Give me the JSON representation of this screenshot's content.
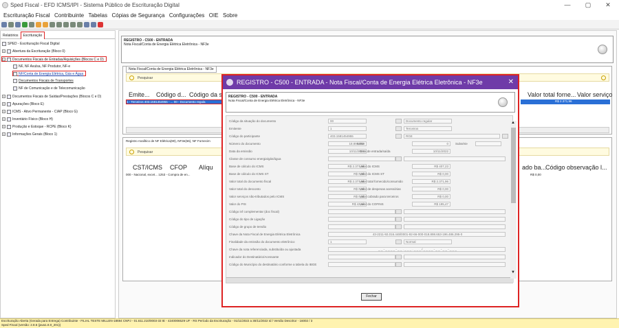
{
  "app": {
    "title": "Sped Fiscal - EFD ICMS/IPI - Sistema Público de Escrituração Digital",
    "min": "—",
    "max": "▢",
    "close": "✕"
  },
  "menu": [
    "Escrituração Fiscal",
    "Contribuinte",
    "Tabelas",
    "Cópias de Segurança",
    "Configurações",
    "OIE",
    "Sobre"
  ],
  "left_tabs": [
    "Relatórios",
    "Escrituração"
  ],
  "tree": [
    {
      "label": "SPED - Escrituração Fiscal Digital"
    },
    {
      "label": "Abertura da Escrituração (Bloco 0)"
    },
    {
      "label": "Documentos Fiscais de Entradas/Aquisições (Blocos C e D)"
    },
    {
      "label": "NF, NF Avulsa, NF Produtor, NF-e"
    },
    {
      "label": "NF/Conta de Energia Elétrica, Gás e Água"
    },
    {
      "label": "Documentos Fiscais de Transportes"
    },
    {
      "label": "NF de Comunicação e de Telecomunicação"
    },
    {
      "label": "Documentos Fiscais de Saídas/Prestações (Blocos C e D)"
    },
    {
      "label": "Apurações (Bloco E)"
    },
    {
      "label": "ICMS - Ativo Permanente - CIAP (Bloco G)"
    },
    {
      "label": "Inventário Físico (Bloco H)"
    },
    {
      "label": "Produção e Estoque - RCPE (Bloco K)"
    },
    {
      "label": "Informações Gerais (Bloco 1)"
    }
  ],
  "main": {
    "hdr_title": "REGISTRO - C500 - ENTRADA",
    "hdr_sub": "Nota Fiscal/Conta de Energia Elétrica Eletrônica - NF3e",
    "tab1": "Nota Fiscal/Conta de Energia Elétrica Eletrônica - NF3e",
    "search": "Pesquisar",
    "cols1": [
      "Emite...",
      "Código d...",
      "Código da s"
    ],
    "row1": "1 - Terceiros   403.1581454955 - ...  00 - Documento regula",
    "cols1r": [
      "Valor total forne...",
      "Valor serviço"
    ],
    "row1r": "R$ 2.371,96",
    "tab2": "Registro Analítico de NF Elétrica(90), NF3e(66), NF Fornecim",
    "search2": "Pesquisar",
    "cols2": [
      "CST/ICMS",
      "CFOP",
      "Alíqu"
    ],
    "row2": "000 - Nacional, excet...  1253 - Compra de en...",
    "cols2r": [
      "ado ba...",
      "Código observação l..."
    ],
    "row2r": "R$ 0,00"
  },
  "dialog": {
    "title": "REGISTRO - C500 - ENTRADA - Nota Fiscal/Conta de Energia Elétrica Eletrônica - NF3e",
    "h1": "REGISTRO - C500 - ENTRADA",
    "h2": "Nota Fiscal/Conta de Energia Elétrica Eletrônica - NF3e",
    "fields": [
      {
        "l": "Código da situação do documento",
        "v": "00",
        "v2": "Documento regular"
      },
      {
        "l": "Emitente",
        "v": "1",
        "v2": "Terceiros"
      },
      {
        "l": "Código do participante",
        "v": "403.1581454955",
        "v2": "RGE"
      },
      {
        "l": "Número do documento",
        "v": "18.898.653",
        "l2": "Série",
        "v3": "0",
        "l3": "Subsérie"
      },
      {
        "l": "Data da emissão",
        "v": "10/11/2022",
        "l2": "Data de entrada/saída",
        "v3": "10/11/2022"
      },
      {
        "l": "Classe de consumo energia/gás/água"
      },
      {
        "l": "Base de cálculo do ICMS",
        "v": "R$ 2.371,96",
        "l2": "Valor do ICMS",
        "v3": "R$ 407,23"
      },
      {
        "l": "Base de cálculo do ICMS ST",
        "v": "R$ 0,00",
        "l2": "Valor do ICMS ST",
        "v3": "R$ 0,00"
      },
      {
        "l": "Valor total do documento fiscal",
        "v": "R$ 2.371,96",
        "l2": "Valor total fornecido/consumido",
        "v3": "R$ 2.371,96"
      },
      {
        "l": "Valor total do desconto",
        "v": "R$ 0,00",
        "l2": "Valor de despesas acessórias",
        "v3": "R$ 0,00"
      },
      {
        "l": "Valor serviços não-tributados pelo ICMS",
        "v": "R$ 0,00",
        "l2": "Valor cobrado para terceiros",
        "v3": "R$ 0,00"
      },
      {
        "l": "Valor do PIS",
        "v": "R$ 42,44",
        "l2": "Valor do COFINS",
        "v3": "R$ 195,47"
      },
      {
        "l": "Código inf complementar (doc fiscal)"
      },
      {
        "l": "Código do tipo de Ligação"
      },
      {
        "l": "Código de grupo de tensão"
      },
      {
        "l": "Chave da Nota Fiscal de Energia Elétrica Eletrônica",
        "v": "43-2211-92.016.448/0001-92-66-000-018.898.653-196.486.295-0"
      },
      {
        "l": "Finalidade da emissão do documento eletrônico",
        "v": "1",
        "v2": "Normal"
      },
      {
        "l": "Chave da nota referenciada, substituída ou ajustada",
        "v": "_ _ - _ _ _ _ - _ _ . _ _ _ . _ _ _ / _ _ _ _ - _ _ - _ _ - _ _ _"
      },
      {
        "l": "Indicador do Destinatário/Acessante"
      },
      {
        "l": "Código do Município do destinatário conforme a tabela do IBGE"
      }
    ],
    "close_btn": "Fechar"
  },
  "status": {
    "line1": "Escrituração Aberta (Gerada para Entrega) Contribuinte - FILIAL TESTE MILLEN-18694 CNPJ - 01.611.210/0003-33 IE - 4240006529 UF - RS Período da Escrituração - 01/11/2022 a 30/11/2022 Id / Versão Descritor - 16002 / 3",
    "line2": "Sped Fiscal (versão: 2.8.6 (java1.8.0_201))"
  }
}
